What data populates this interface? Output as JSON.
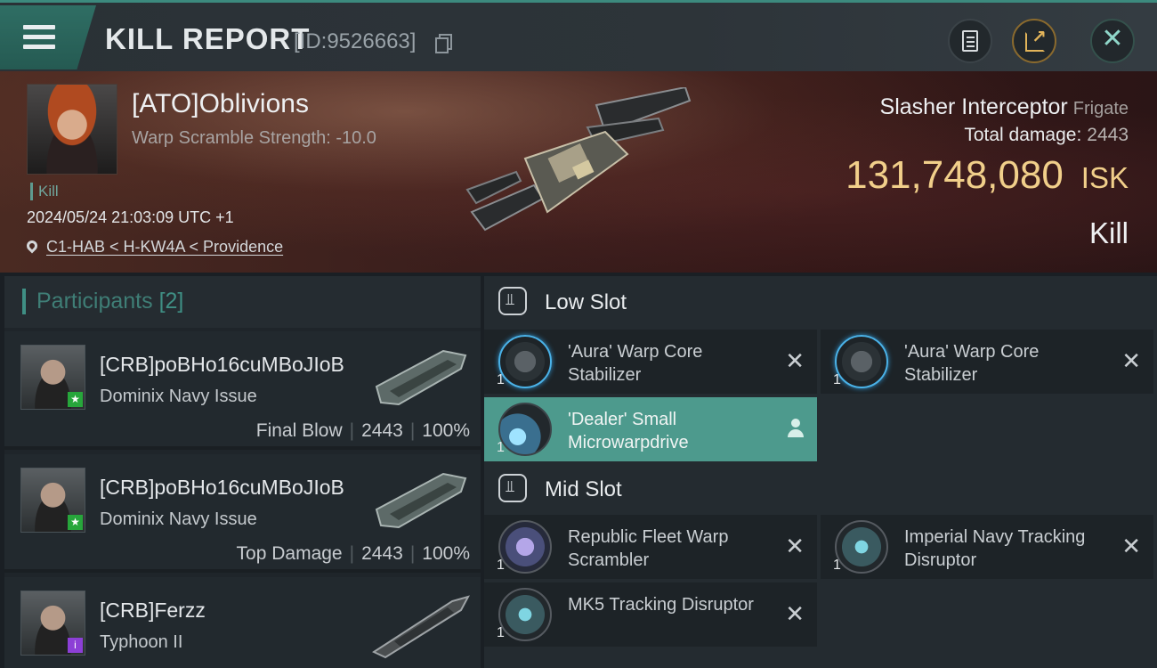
{
  "header": {
    "title": "KILL REPORT",
    "report_id": "[ID:9526663]"
  },
  "victim": {
    "name": "[ATO]Oblivions",
    "subtitle": "Warp Scramble Strength: -10.0",
    "tag": "Kill",
    "datetime": "2024/05/24 21:03:09 UTC +1",
    "location": "C1-HAB < H-KW4A < Providence",
    "ship_name": "Slasher Interceptor",
    "ship_class": "Frigate",
    "total_damage_label": "Total damage:",
    "total_damage": "2443",
    "isk_value": "131,748,080",
    "isk_unit": "ISK",
    "outcome": "Kill"
  },
  "participants": {
    "title": "Participants",
    "count": "[2]",
    "rows": [
      {
        "name": "[CRB]poBHo16cuMBoJIoB",
        "ship": "Dominix Navy Issue",
        "role": "Final Blow",
        "damage": "2443",
        "percent": "100%"
      },
      {
        "name": "[CRB]poBHo16cuMBoJIoB",
        "ship": "Dominix Navy Issue",
        "role": "Top Damage",
        "damage": "2443",
        "percent": "100%"
      },
      {
        "name": "[CRB]Ferzz",
        "ship": "Typhoon II"
      }
    ]
  },
  "slots": {
    "low_slot_label": "Low Slot",
    "mid_slot_label": "Mid Slot",
    "low": [
      {
        "name": "'Aura' Warp Core Stabilizer",
        "qty": "1"
      },
      {
        "name": "'Aura' Warp Core Stabilizer",
        "qty": "1"
      },
      {
        "name": "'Dealer' Small Microwarpdrive",
        "qty": "1"
      }
    ],
    "mid": [
      {
        "name": "Republic Fleet Warp Scrambler",
        "qty": "1"
      },
      {
        "name": "Imperial Navy Tracking Disruptor",
        "qty": "1"
      },
      {
        "name": "MK5 Tracking Disruptor",
        "qty": "1"
      }
    ]
  },
  "colors": {
    "accent_teal": "#3f8f84",
    "isk_gold": "#f1cf8a",
    "highlight": "#4d9a8d"
  }
}
